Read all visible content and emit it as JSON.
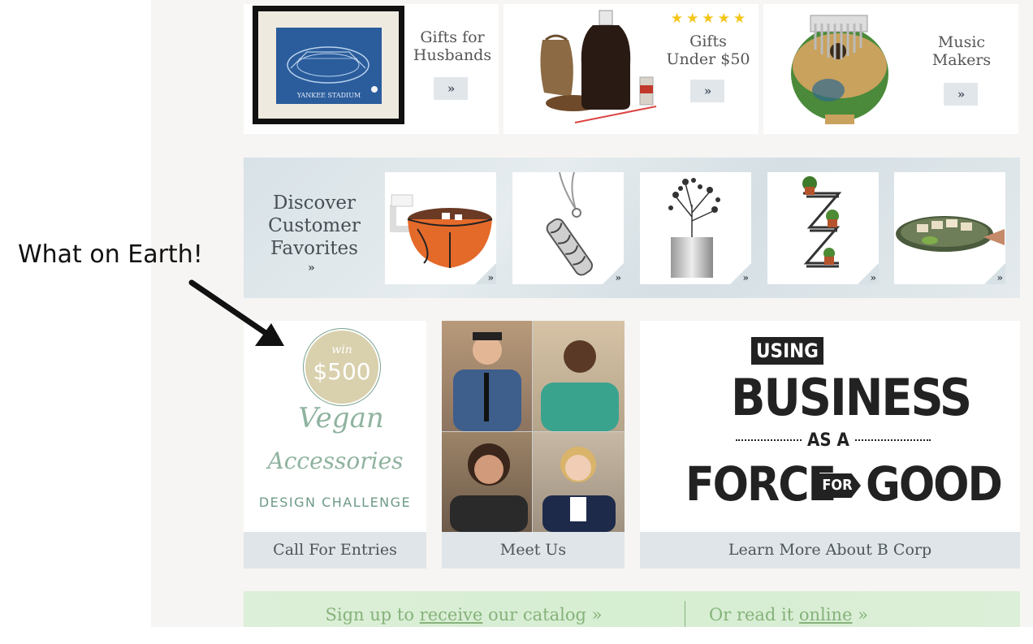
{
  "gift_cards": [
    {
      "label_line1": "Gifts for",
      "label_line2": "Husbands",
      "arrow": "»"
    },
    {
      "label_line1": "Gifts",
      "label_line2": "Under $50",
      "arrow": "»",
      "stars": "★★★★★"
    },
    {
      "label_line1": "Music",
      "label_line2": "Makers",
      "arrow": "»"
    }
  ],
  "blueprint_caption": "YANKEE STADIUM",
  "favorites": {
    "title_line1": "Discover",
    "title_line2": "Customer",
    "title_line3": "Favorites",
    "more": "»",
    "tiles": [
      {
        "name": "basketball-mug",
        "arrow": "»"
      },
      {
        "name": "pendant-necklace",
        "arrow": "»"
      },
      {
        "name": "tree-planter",
        "arrow": "»"
      },
      {
        "name": "wall-planter",
        "arrow": "»"
      },
      {
        "name": "serving-plate",
        "arrow": "»"
      }
    ]
  },
  "promos": {
    "challenge": {
      "win": "win",
      "amount": "$500",
      "script_line1": "Vegan",
      "script_line2": "Accessories",
      "subtitle": "DESIGN CHALLENGE",
      "caption": "Call For Entries"
    },
    "team": {
      "caption": "Meet Us"
    },
    "bcorp": {
      "using": "USING",
      "business": "BUSINESS",
      "as_a": "AS A",
      "force": "FORCE",
      "for": "FOR",
      "good": "GOOD",
      "caption": "Learn More About B Corp"
    }
  },
  "signup": {
    "part1": "Sign up to ",
    "link1": "receive",
    "part2": " our catalog »",
    "part3": "Or read it ",
    "link2": "online",
    "part4": " »"
  },
  "annotation": "What on Earth!",
  "colors": {
    "page_bg": "#f6f5f3",
    "caption_bg": "#dfe5e9",
    "signup_bg": "#d6eed2",
    "signup_text": "#86b27a",
    "star": "#f5c518"
  }
}
